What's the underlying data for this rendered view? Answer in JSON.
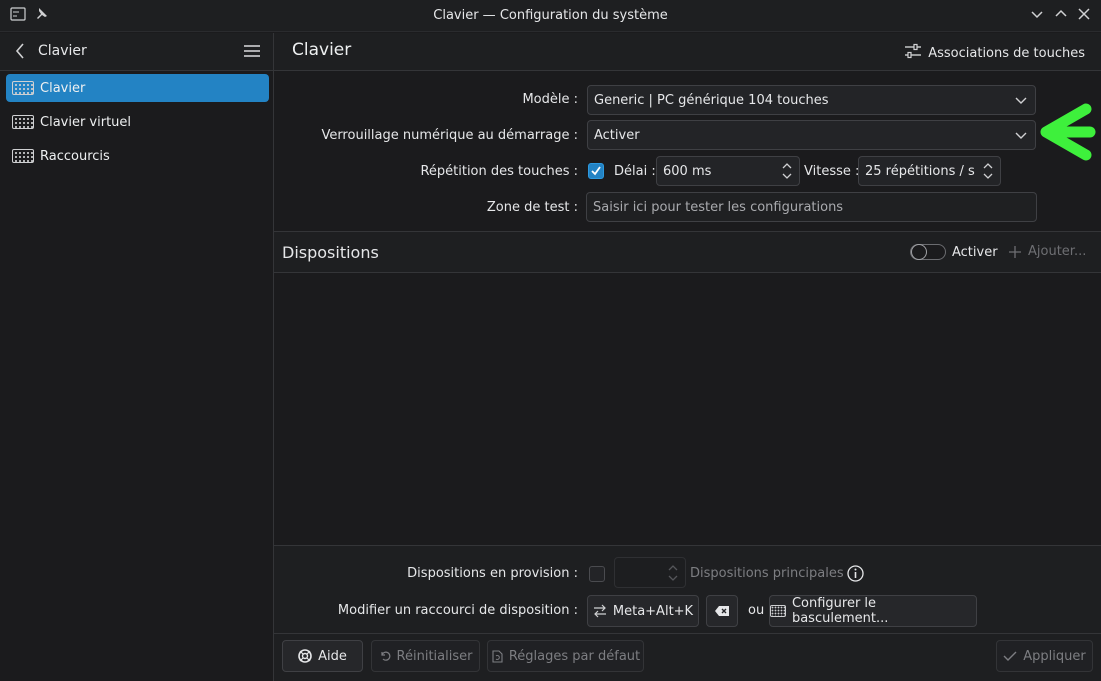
{
  "window": {
    "title": "Clavier — Configuration du système"
  },
  "sidebar": {
    "title": "Clavier",
    "items": [
      {
        "label": "Clavier",
        "active": true
      },
      {
        "label": "Clavier virtuel",
        "active": false
      },
      {
        "label": "Raccourcis",
        "active": false
      }
    ]
  },
  "main": {
    "title": "Clavier",
    "assoc_button": "Associations de touches"
  },
  "form": {
    "model_label": "Modèle :",
    "model_value": "Generic | PC générique 104 touches",
    "numlock_label": "Verrouillage numérique au démarrage :",
    "numlock_value": "Activer",
    "repeat_label": "Répétition des touches :",
    "repeat_checked": true,
    "delay_label": "Délai :",
    "delay_value": "600 ms",
    "speed_label": "Vitesse :",
    "speed_value": "25 répétitions / s",
    "test_label": "Zone de test :",
    "test_placeholder": "Saisir ici pour tester les configurations"
  },
  "layouts": {
    "title": "Dispositions",
    "toggle_label": "Activer",
    "toggle_on": false,
    "add_label": "Ajouter..."
  },
  "spare": {
    "label": "Dispositions en provision :",
    "main_label": "Dispositions principales"
  },
  "shortcut": {
    "label": "Modifier un raccourci de disposition :",
    "value": "Meta+Alt+K",
    "or_label": "ou",
    "configure_label": "Configurer le basculement..."
  },
  "footer": {
    "help": "Aide",
    "reset": "Réinitialiser",
    "defaults": "Réglages par défaut",
    "apply": "Appliquer"
  },
  "colors": {
    "accent": "#2383c4",
    "annotation_arrow": "#3ef03c"
  }
}
